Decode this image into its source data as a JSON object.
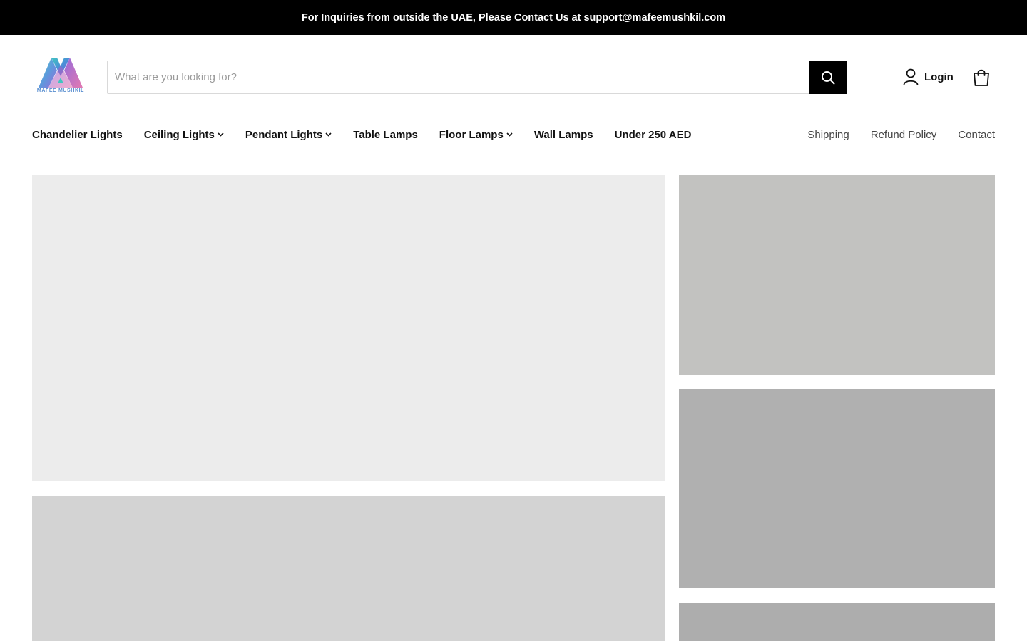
{
  "announcement": {
    "text": "For Inquiries from outside the UAE, Please Contact Us at support@mafeemushkil.com"
  },
  "brand": {
    "logo_text": "MAFEE MUSHKIL",
    "colors": {
      "teal": "#3fc6c0",
      "purple": "#8a5bd6",
      "pink": "#e06aa8",
      "blue": "#4a8fd8"
    }
  },
  "search": {
    "placeholder": "What are you looking for?",
    "value": "",
    "button_icon": "search-icon"
  },
  "account": {
    "login_label": "Login",
    "login_icon": "user-icon",
    "cart_icon": "cart-icon"
  },
  "nav": {
    "items": [
      {
        "label": "Chandelier Lights",
        "has_dropdown": false
      },
      {
        "label": "Ceiling Lights",
        "has_dropdown": true
      },
      {
        "label": "Pendant Lights",
        "has_dropdown": true
      },
      {
        "label": "Table Lamps",
        "has_dropdown": false
      },
      {
        "label": "Floor Lamps",
        "has_dropdown": true
      },
      {
        "label": "Wall Lamps",
        "has_dropdown": false
      },
      {
        "label": "Under 250 AED",
        "has_dropdown": false
      }
    ],
    "secondary": [
      {
        "label": "Shipping"
      },
      {
        "label": "Refund Policy"
      },
      {
        "label": "Contact"
      }
    ]
  },
  "tiles": {
    "colors": [
      "#ececec",
      "#d3d3d3",
      "#c2c2c0",
      "#b0b0b0",
      "#adadad"
    ]
  }
}
